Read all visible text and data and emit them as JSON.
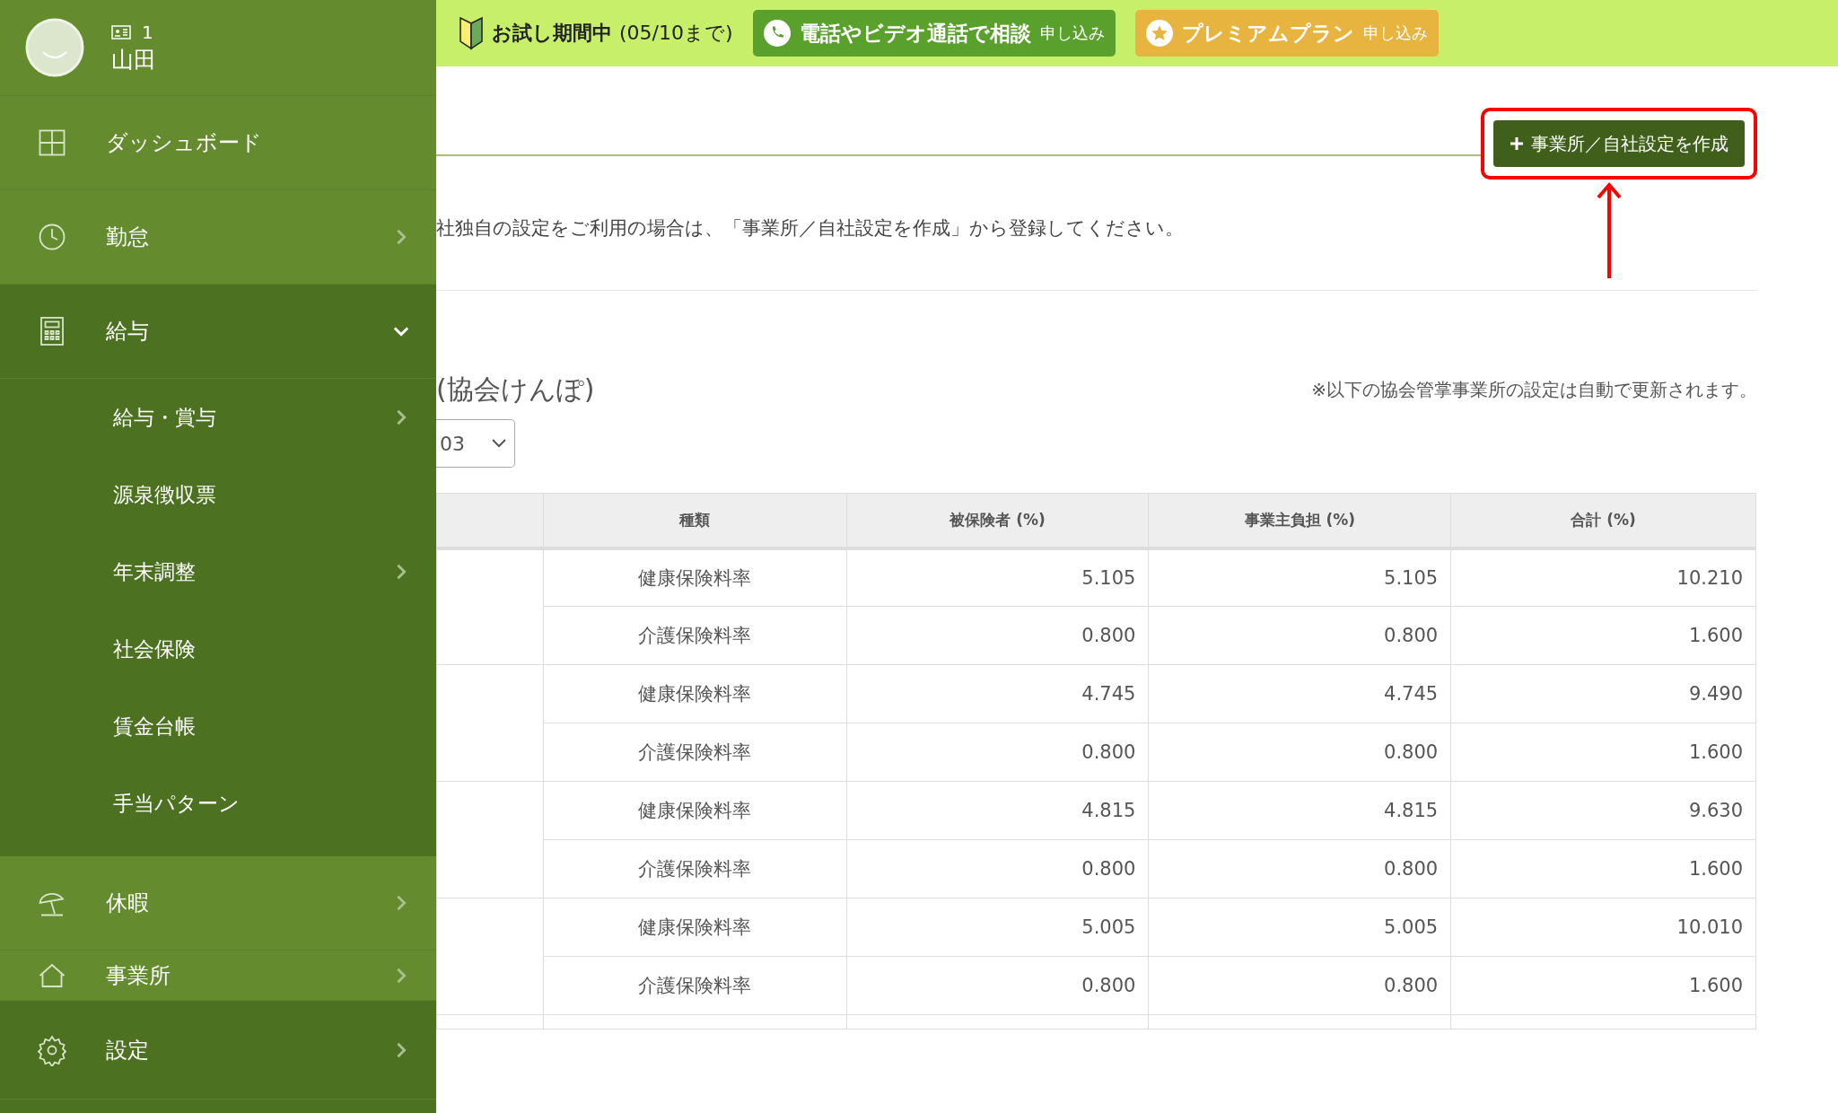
{
  "sidebar": {
    "user": {
      "id": "1",
      "name": "山田"
    },
    "items": [
      {
        "kind": "dashboard",
        "label": "ダッシュボード",
        "selected": false,
        "has_arrow": false
      },
      {
        "kind": "clock",
        "label": "勤怠",
        "selected": false,
        "has_arrow": true
      },
      {
        "kind": "calculator",
        "label": "給与",
        "selected": true,
        "has_arrow": true,
        "expanded": true,
        "children": [
          {
            "label": "給与・賞与",
            "has_arrow": true
          },
          {
            "label": "源泉徴収票",
            "has_arrow": false
          },
          {
            "label": "年末調整",
            "has_arrow": true
          },
          {
            "label": "社会保険",
            "has_arrow": false
          },
          {
            "label": "賃金台帳",
            "has_arrow": false
          },
          {
            "label": "手当パターン",
            "has_arrow": false
          }
        ]
      },
      {
        "kind": "umbrella",
        "label": "休暇",
        "selected": false,
        "has_arrow": true
      },
      {
        "kind": "house",
        "label": "事業所",
        "selected": false,
        "has_arrow": true
      }
    ],
    "footer": {
      "kind": "gear",
      "label": "設定",
      "has_arrow": true
    }
  },
  "topbar": {
    "trial": {
      "label": "お試し期間中",
      "period": "(05/10まで)"
    },
    "buttons": [
      {
        "kind": "phone",
        "label": "電話やビデオ通話で相談",
        "action": "申し込み"
      },
      {
        "kind": "star",
        "label": "プレミアムプラン",
        "action": "申し込み"
      }
    ]
  },
  "create_button": {
    "label": "事業所／自社設定を作成",
    "highlighted": true
  },
  "notice": "社独自の設定をご利用の場合は、「事業所／自社設定を作成」から登録してください。",
  "section": {
    "title": "(協会けんぽ)",
    "note": "※以下の協会管掌事業所の設定は自動で更新されます。",
    "select_value": "03"
  },
  "table": {
    "columns": [
      "",
      "種類",
      "被保険者 (%)",
      "事業主負担 (%)",
      "合計 (%)"
    ],
    "groups": [
      {
        "rows": [
          [
            "健康保険料率",
            "5.105",
            "5.105",
            "10.210"
          ],
          [
            "介護保険料率",
            "0.800",
            "0.800",
            "1.600"
          ]
        ]
      },
      {
        "rows": [
          [
            "健康保険料率",
            "4.745",
            "4.745",
            "9.490"
          ],
          [
            "介護保険料率",
            "0.800",
            "0.800",
            "1.600"
          ]
        ]
      },
      {
        "rows": [
          [
            "健康保険料率",
            "4.815",
            "4.815",
            "9.630"
          ],
          [
            "介護保険料率",
            "0.800",
            "0.800",
            "1.600"
          ]
        ]
      },
      {
        "rows": [
          [
            "健康保険料率",
            "5.005",
            "5.005",
            "10.010"
          ],
          [
            "介護保険料率",
            "0.800",
            "0.800",
            "1.600"
          ]
        ]
      }
    ]
  }
}
